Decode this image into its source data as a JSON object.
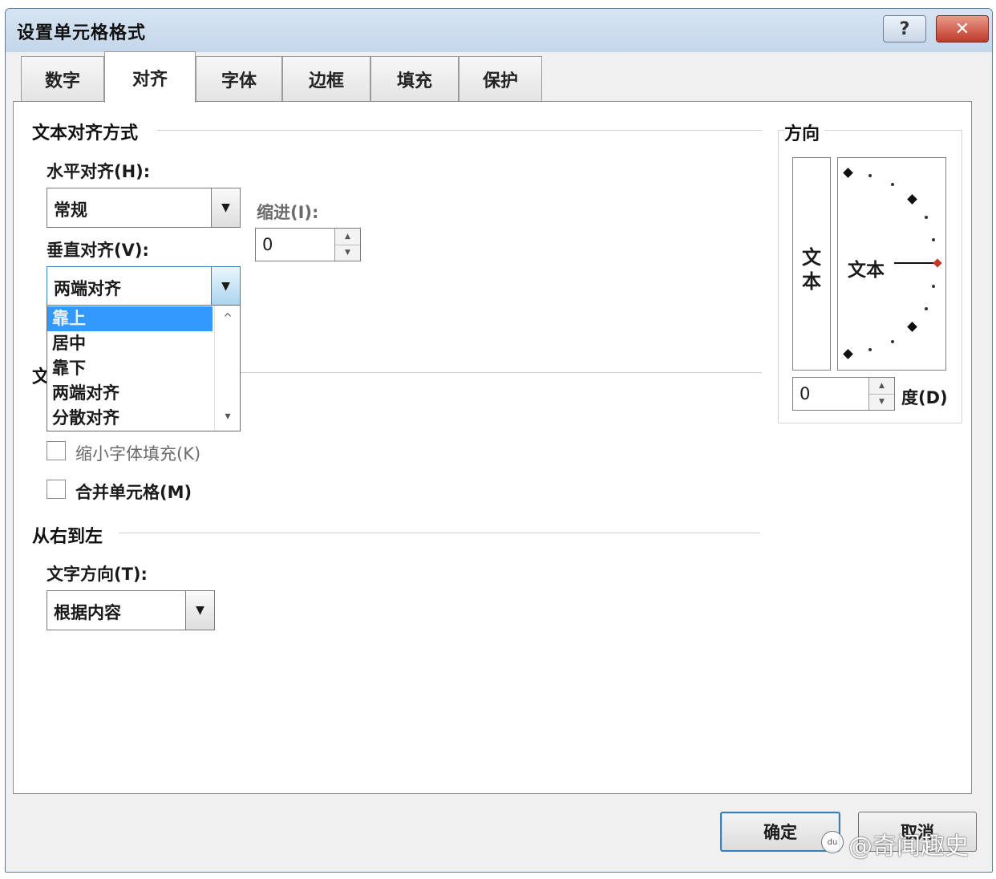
{
  "window": {
    "title": "设置单元格格式",
    "help_glyph": "?",
    "close_glyph": "✕"
  },
  "tabs": [
    {
      "label": "数字",
      "active": false
    },
    {
      "label": "对齐",
      "active": true
    },
    {
      "label": "字体",
      "active": false
    },
    {
      "label": "边框",
      "active": false
    },
    {
      "label": "填充",
      "active": false
    },
    {
      "label": "保护",
      "active": false
    }
  ],
  "alignment": {
    "group_title": "文本对齐方式",
    "horizontal": {
      "label": "水平对齐(H):",
      "value": "常规"
    },
    "indent": {
      "label": "缩进(I):",
      "value": "0"
    },
    "vertical": {
      "label": "垂直对齐(V):",
      "value": "两端对齐",
      "options": [
        "靠上",
        "居中",
        "靠下",
        "两端对齐",
        "分散对齐"
      ],
      "highlighted": "靠上"
    }
  },
  "text_control": {
    "group_title_partial": "文",
    "shrink_label": "缩小字体填充(K)",
    "merge_label": "合并单元格(M)"
  },
  "rtl": {
    "group_title": "从右到左",
    "direction": {
      "label": "文字方向(T):",
      "value": "根据内容"
    }
  },
  "orientation": {
    "group_title": "方向",
    "vertical_text": [
      "文",
      "本"
    ],
    "dial_text": "文本",
    "degrees": {
      "value": "0",
      "label": "度(D)"
    }
  },
  "footer": {
    "ok_label": "确定",
    "cancel_label": "取消"
  },
  "watermark": "@奇闻趣史"
}
